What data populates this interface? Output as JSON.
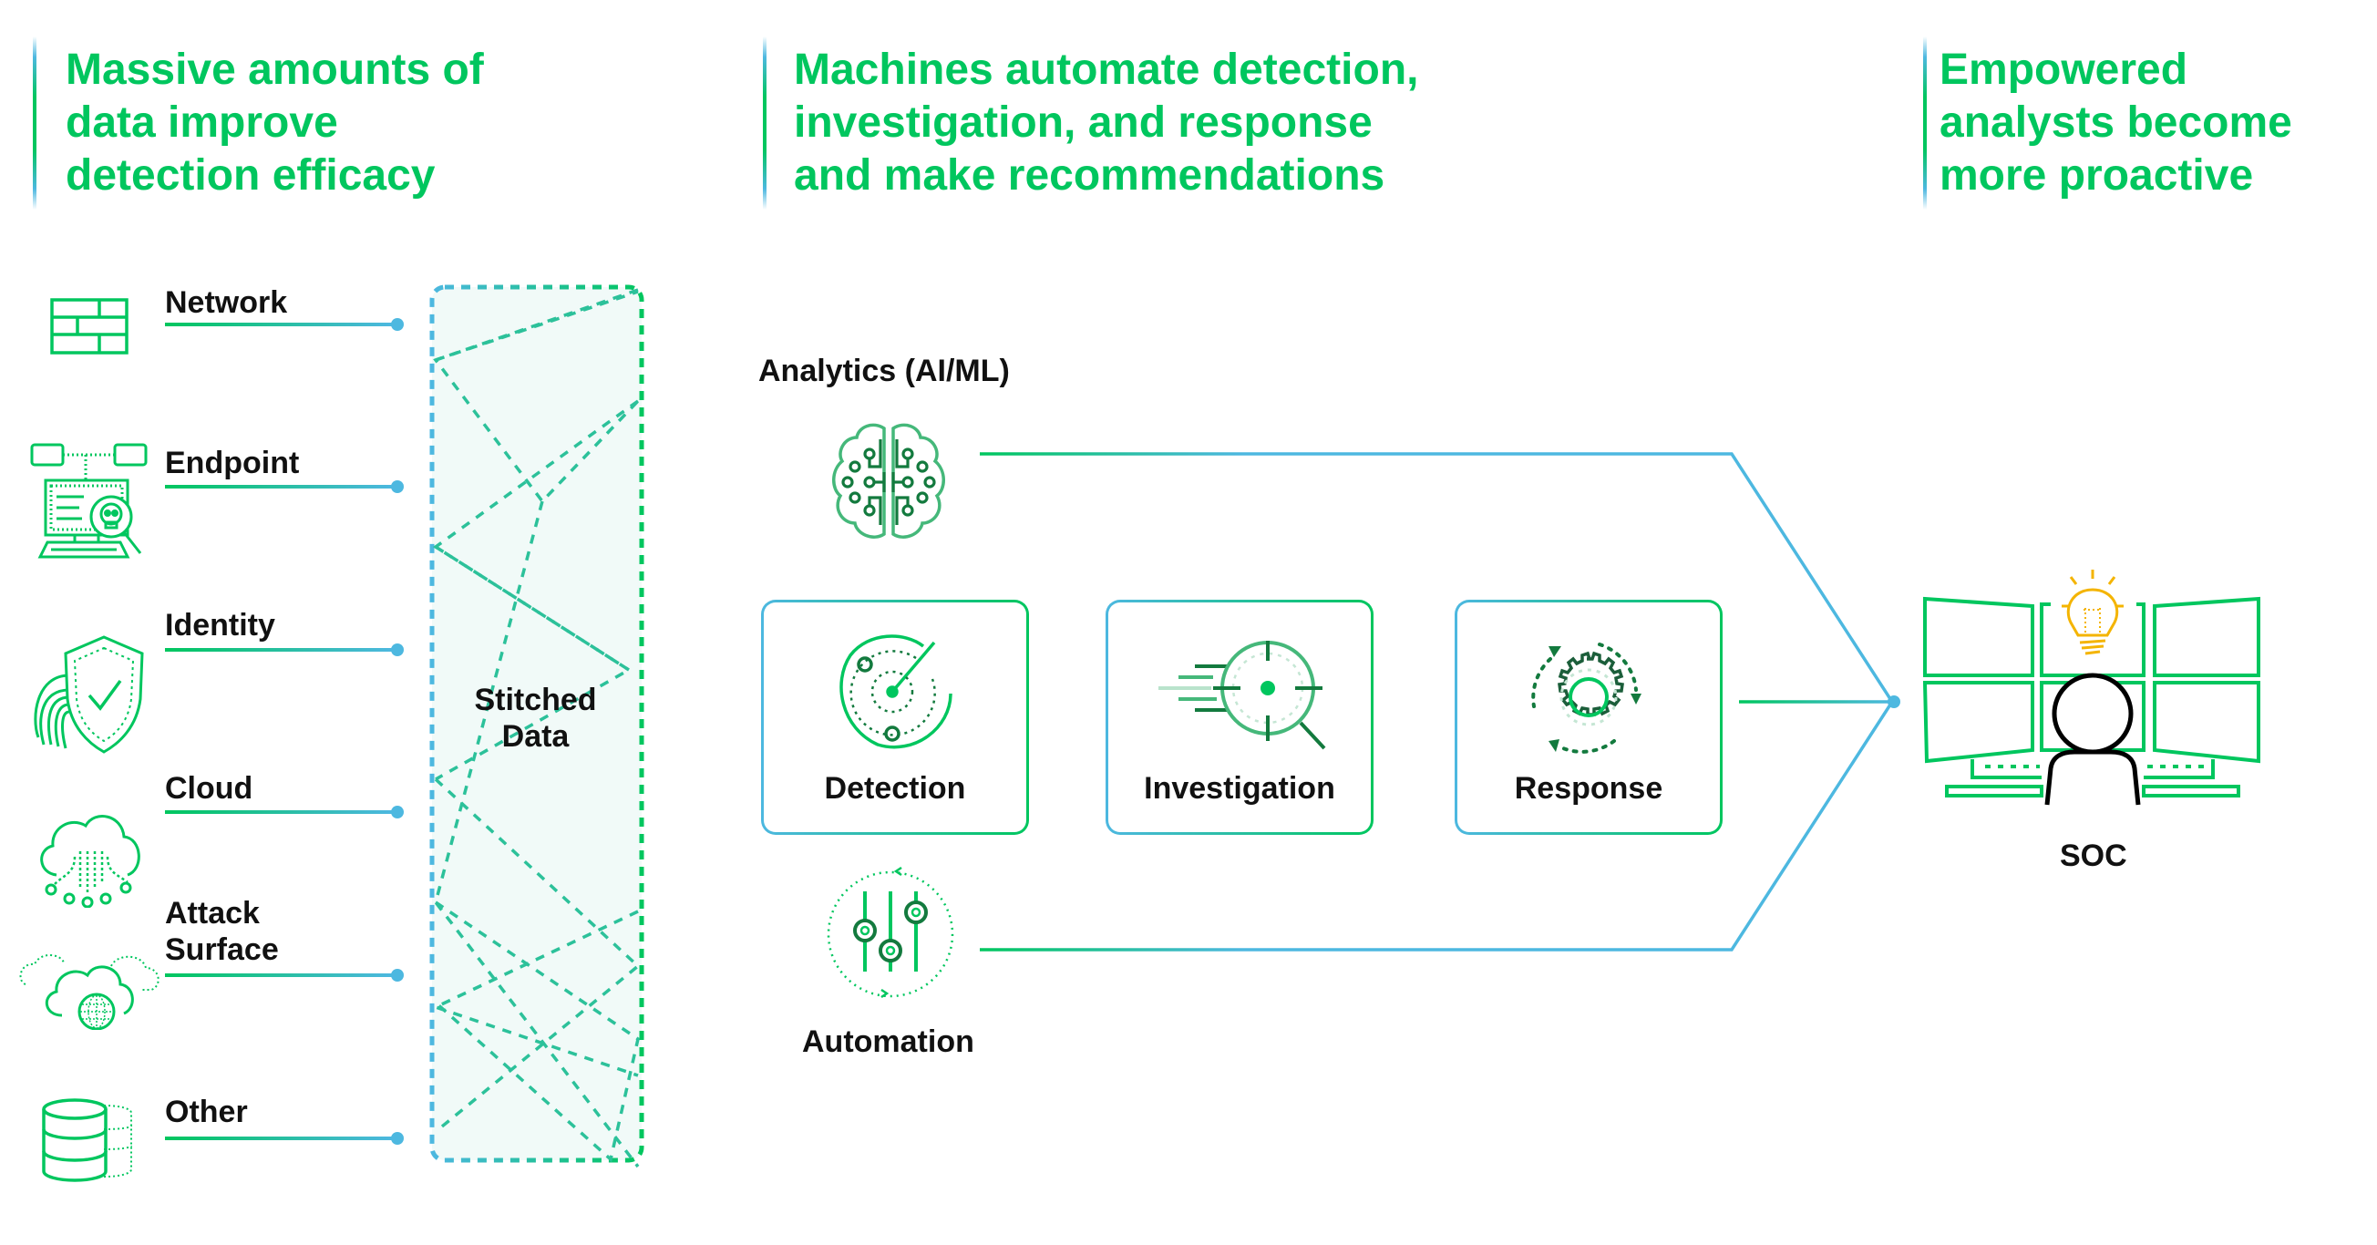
{
  "headers": [
    {
      "id": "data",
      "text": "Massive amounts of\ndata improve\ndetection efficacy"
    },
    {
      "id": "machines",
      "text": "Machines automate detection,\ninvestigation, and response\nand make recommendations"
    },
    {
      "id": "analysts",
      "text": "Empowered\nanalysts become\nmore proactive"
    }
  ],
  "sources": [
    {
      "label": "Network",
      "icon": "firewall-icon"
    },
    {
      "label": "Endpoint",
      "icon": "endpoint-computer-icon"
    },
    {
      "label": "Identity",
      "icon": "fingerprint-shield-icon"
    },
    {
      "label": "Cloud",
      "icon": "cloud-icon"
    },
    {
      "label": "Attack\nSurface",
      "icon": "cloud-globe-icon"
    },
    {
      "label": "Other",
      "icon": "database-icon"
    }
  ],
  "stitched": {
    "label": "Stitched\nData"
  },
  "analytics": {
    "label": "Analytics (AI/ML)",
    "icon": "brain-circuit-icon"
  },
  "stages": [
    {
      "label": "Detection",
      "icon": "radar-icon"
    },
    {
      "label": "Investigation",
      "icon": "target-magnifier-icon"
    },
    {
      "label": "Response",
      "icon": "gear-cycle-icon"
    }
  ],
  "automation": {
    "label": "Automation",
    "icon": "sliders-cycle-icon"
  },
  "soc": {
    "label": "SOC",
    "icon": "analyst-monitors-icon"
  },
  "colors": {
    "green": "#00c65e",
    "blue": "#4db8e0",
    "dark_green": "#137a3e",
    "bulb": "#f4b400",
    "text": "#111111"
  }
}
